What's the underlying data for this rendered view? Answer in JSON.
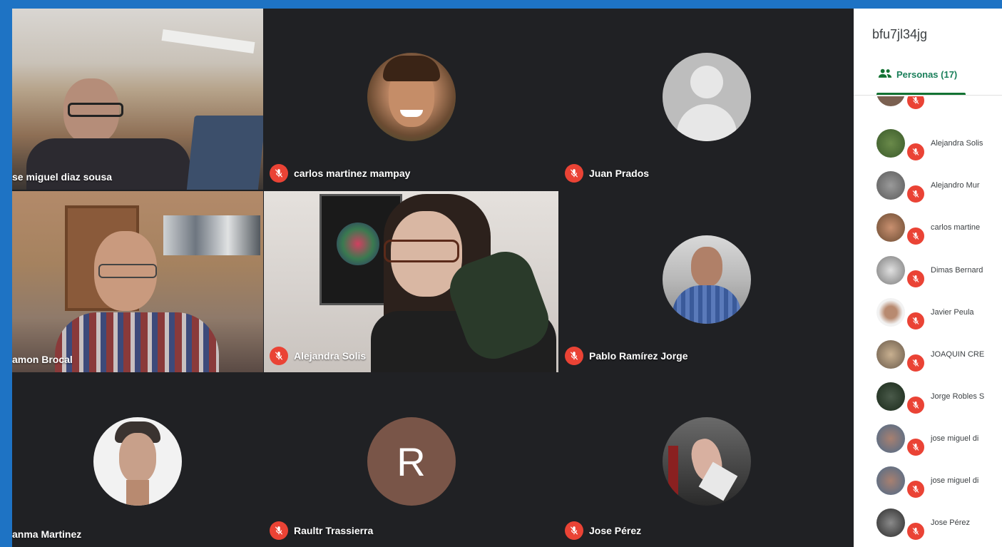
{
  "meeting": {
    "code": "bfu7jl34jg"
  },
  "colors": {
    "mic_off": "#ea4335",
    "tab_green": "#137333",
    "tile_bg": "#3c4043",
    "app_bg": "#202124"
  },
  "tiles": [
    {
      "name": "se miguel diaz sousa",
      "kind": "video",
      "muted": false
    },
    {
      "name": "carlos martinez mampay",
      "kind": "avatar",
      "muted": true
    },
    {
      "name": "Juan Prados",
      "kind": "default-avatar",
      "muted": true
    },
    {
      "name": "amon Brocal",
      "kind": "video",
      "muted": false
    },
    {
      "name": "Alejandra Solis",
      "kind": "video",
      "muted": true
    },
    {
      "name": "Pablo Ramírez Jorge",
      "kind": "avatar",
      "muted": true
    },
    {
      "name": "anma Martinez",
      "kind": "avatar",
      "muted": false
    },
    {
      "name": "Raultr Trassierra",
      "kind": "initial",
      "initial": "R",
      "muted": true
    },
    {
      "name": "Jose Pérez",
      "kind": "avatar",
      "muted": true
    }
  ],
  "sidebar": {
    "tab_label": "Personas (17)",
    "tab_icon": "people-icon",
    "participants": [
      {
        "name": ""
      },
      {
        "name": "Alejandra Solis"
      },
      {
        "name": "Alejandro Mur"
      },
      {
        "name": "carlos martine"
      },
      {
        "name": "Dimas Bernard"
      },
      {
        "name": "Javier Peula"
      },
      {
        "name": "JOAQUIN CRE"
      },
      {
        "name": "Jorge Robles S"
      },
      {
        "name": "jose miguel di"
      },
      {
        "name": "jose miguel di"
      },
      {
        "name": "Jose Pérez"
      }
    ]
  }
}
